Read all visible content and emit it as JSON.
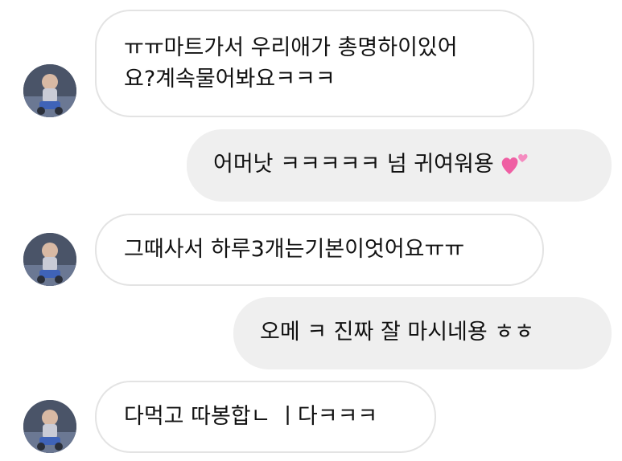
{
  "conversation": {
    "messages": [
      {
        "direction": "incoming",
        "lines": [
          "ㅠㅠ마트가서 우리애가 총명하이있어",
          "요?계속물어봐요ㅋㅋㅋ"
        ],
        "avatar_icon": "child-photo-avatar"
      },
      {
        "direction": "outgoing",
        "text": "어머낫 ㅋㅋㅋㅋㅋ 넘 귀여워용",
        "emoji": "two-hearts-emoji"
      },
      {
        "direction": "incoming",
        "text": "그때사서 하루3개는기본이엇어요ㅠㅠ",
        "avatar_icon": "child-photo-avatar"
      },
      {
        "direction": "outgoing",
        "text": "오메 ㅋ  진짜 잘 마시네용 ㅎㅎ"
      },
      {
        "direction": "incoming",
        "text": "다먹고 따봉합ㄴ ㅣ다ㅋㅋㅋ",
        "avatar_icon": "child-photo-avatar"
      }
    ]
  },
  "colors": {
    "incoming_bubble_bg": "#ffffff",
    "incoming_bubble_border": "#e3e3e3",
    "outgoing_bubble_bg": "#efefef",
    "text": "#111111",
    "heart_pink": "#f06aa9"
  }
}
